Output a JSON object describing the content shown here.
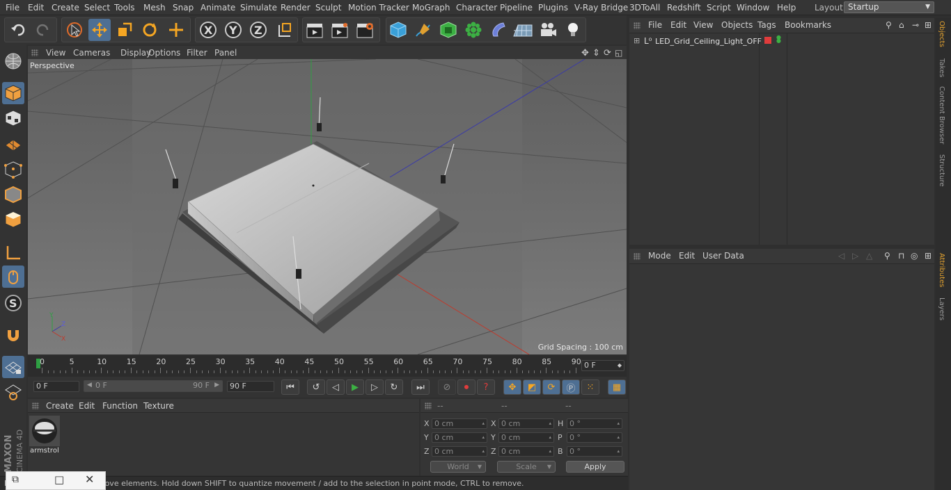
{
  "menu": [
    "File",
    "Edit",
    "Create",
    "Select",
    "Tools",
    "Mesh",
    "Snap",
    "Animate",
    "Simulate",
    "Render",
    "Sculpt",
    "Motion Tracker",
    "MoGraph",
    "Character",
    "Pipeline",
    "Plugins",
    "V-Ray Bridge",
    "3DToAll",
    "Redshift",
    "Script",
    "Window",
    "Help"
  ],
  "layout": {
    "label": "Layout:",
    "value": "Startup"
  },
  "viewport": {
    "menu": [
      "View",
      "Cameras",
      "Display",
      "Options",
      "Filter",
      "Panel"
    ],
    "name": "Perspective",
    "grid_spacing": "Grid Spacing : 100 cm"
  },
  "timeline": {
    "ticks": [
      "0",
      "5",
      "10",
      "15",
      "20",
      "25",
      "30",
      "35",
      "40",
      "45",
      "50",
      "55",
      "60",
      "65",
      "70",
      "75",
      "80",
      "85",
      "90"
    ],
    "current_frame": "0 F"
  },
  "transport": {
    "start": "0 F",
    "range_start": "0 F",
    "range_end": "90 F",
    "end": "90 F"
  },
  "materials": {
    "menu": [
      "Create",
      "Edit",
      "Function",
      "Texture"
    ],
    "items": [
      {
        "name": "armstrol"
      }
    ]
  },
  "coords": {
    "headers": [
      "--",
      "--",
      "--"
    ],
    "rows": [
      {
        "a": "X",
        "av": "0 cm",
        "b": "X",
        "bv": "0 cm",
        "c": "H",
        "cv": "0 °"
      },
      {
        "a": "Y",
        "av": "0 cm",
        "b": "Y",
        "bv": "0 cm",
        "c": "P",
        "cv": "0 °"
      },
      {
        "a": "Z",
        "av": "0 cm",
        "b": "Z",
        "bv": "0 cm",
        "c": "B",
        "cv": "0 °"
      }
    ],
    "mode_select": "World",
    "size_select": "Scale",
    "apply": "Apply"
  },
  "status": "Move: Click and drag to move elements. Hold down SHIFT to quantize movement / add to the selection in point mode, CTRL to remove.",
  "objects": {
    "menu": [
      "File",
      "Edit",
      "View",
      "Objects",
      "Tags",
      "Bookmarks"
    ],
    "items": [
      {
        "name": "LED_Grid_Ceiling_Light_OFF"
      }
    ]
  },
  "attributes": {
    "menu": [
      "Mode",
      "Edit",
      "User Data"
    ]
  },
  "right_tabs": [
    "Objects",
    "Takes",
    "Content Browser",
    "Structure",
    "Attributes",
    "Layers"
  ],
  "brand": {
    "maxon": "MAXON",
    "product": "CINEMA 4D"
  },
  "colors": {
    "accent": "#4e6f93",
    "x_axis": "#c0392b",
    "y_axis": "#2ea043",
    "z_axis": "#3a3aa8",
    "red_tag": "#e03c3c"
  }
}
